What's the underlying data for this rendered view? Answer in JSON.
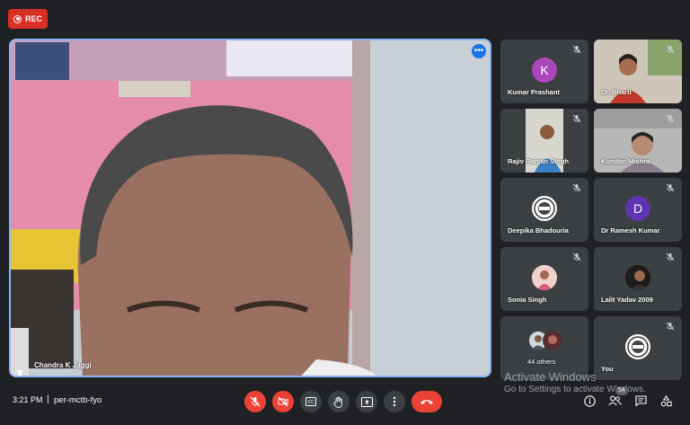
{
  "recording": {
    "label": "REC"
  },
  "main_speaker": {
    "name": "Chandra K Jaggi",
    "more_label": "•••"
  },
  "participants": [
    {
      "name": "Kumar Prashant",
      "initial": "K",
      "avatar_color": "#ab47bc",
      "kind": "letter"
    },
    {
      "name": "Dr. Bharti",
      "kind": "video"
    },
    {
      "name": "Rajiv Ranjan Singh",
      "kind": "video"
    },
    {
      "name": "Kundan Mishra",
      "kind": "video"
    },
    {
      "name": "Deepika Bhadouria",
      "kind": "logo"
    },
    {
      "name": "Dr Ramesh Kumar",
      "initial": "D",
      "avatar_color": "#5e35b1",
      "kind": "letter"
    },
    {
      "name": "Sonia Singh",
      "kind": "photo"
    },
    {
      "name": "Lalit Yadav 2009",
      "kind": "photo"
    },
    {
      "name": "44 others",
      "kind": "group"
    },
    {
      "name": "You",
      "kind": "logo"
    }
  ],
  "bottom_bar": {
    "time": "3:21 PM",
    "separator": "|",
    "meeting_code": "per-mctb-fyo",
    "participant_count": "54"
  },
  "controls": {
    "mic": "mic-off-icon",
    "camera": "camera-off-icon",
    "captions": "captions-icon",
    "raise_hand": "raise-hand-icon",
    "present": "present-icon",
    "more": "more-options-icon",
    "end_call": "end-call-icon",
    "info": "info-icon",
    "people": "people-icon",
    "chat": "chat-icon",
    "activities": "activities-icon"
  },
  "watermark": {
    "title": "Activate Windows",
    "subtitle": "Go to Settings to activate Windows."
  }
}
